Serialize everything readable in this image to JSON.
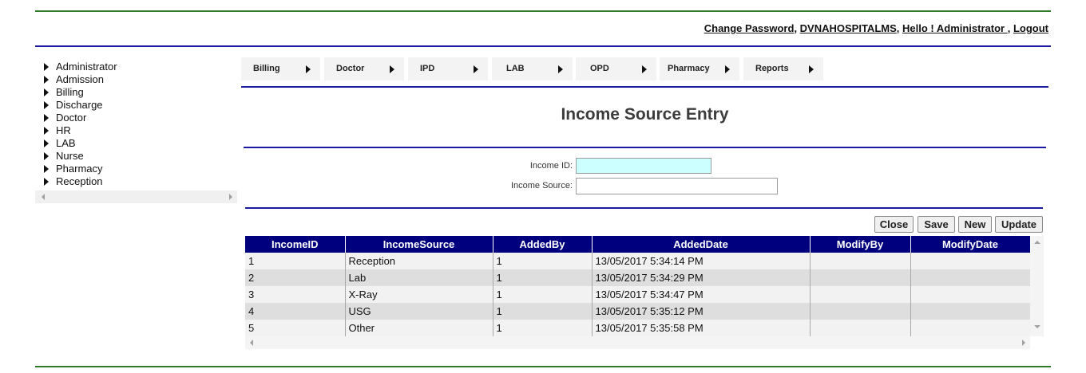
{
  "header": {
    "change_password": "Change Password",
    "hospital": "DVNAHOSPITALMS",
    "greeting": "Hello ! Administrator ",
    "logout": "Logout"
  },
  "sidebar": {
    "items": [
      "Administrator",
      "Admission",
      "Billing",
      "Discharge",
      "Doctor",
      "HR",
      "LAB",
      "Nurse",
      "Pharmacy",
      "Reception"
    ]
  },
  "menu": {
    "items": [
      "Billing",
      "Doctor",
      "IPD",
      "LAB",
      "OPD",
      "Pharmacy",
      "Reports"
    ]
  },
  "page": {
    "title": "Income Source Entry"
  },
  "form": {
    "income_id_label": "Income ID:",
    "income_id_value": "",
    "income_source_label": "Income Source:",
    "income_source_value": ""
  },
  "buttons": {
    "close": "Close",
    "save": "Save",
    "new": "New",
    "update": "Update"
  },
  "grid": {
    "columns": [
      "IncomeID",
      "IncomeSource",
      "AddedBy",
      "AddedDate",
      "ModifyBy",
      "ModifyDate"
    ],
    "rows": [
      [
        "1",
        "Reception",
        "1",
        "13/05/2017 5:34:14 PM",
        "",
        ""
      ],
      [
        "2",
        "Lab",
        "1",
        "13/05/2017 5:34:29 PM",
        "",
        ""
      ],
      [
        "3",
        "X-Ray",
        "1",
        "13/05/2017 5:34:47 PM",
        "",
        ""
      ],
      [
        "4",
        "USG",
        "1",
        "13/05/2017 5:35:12 PM",
        "",
        ""
      ],
      [
        "5",
        "Other",
        "1",
        "13/05/2017 5:35:58 PM",
        "",
        ""
      ]
    ]
  },
  "colors": {
    "header_blue": "#00007f",
    "rule_blue": "#1a1aa0",
    "rule_green": "#2a7a2a",
    "income_id_bg": "#ccffff"
  },
  "icons": {
    "expand": "triangle-right-icon",
    "menu_arrow": "triangle-right-icon",
    "scroll_left": "scroll-left-arrow-icon",
    "scroll_right": "scroll-right-arrow-icon",
    "scroll_up": "scroll-up-arrow-icon",
    "scroll_down": "scroll-down-arrow-icon"
  }
}
